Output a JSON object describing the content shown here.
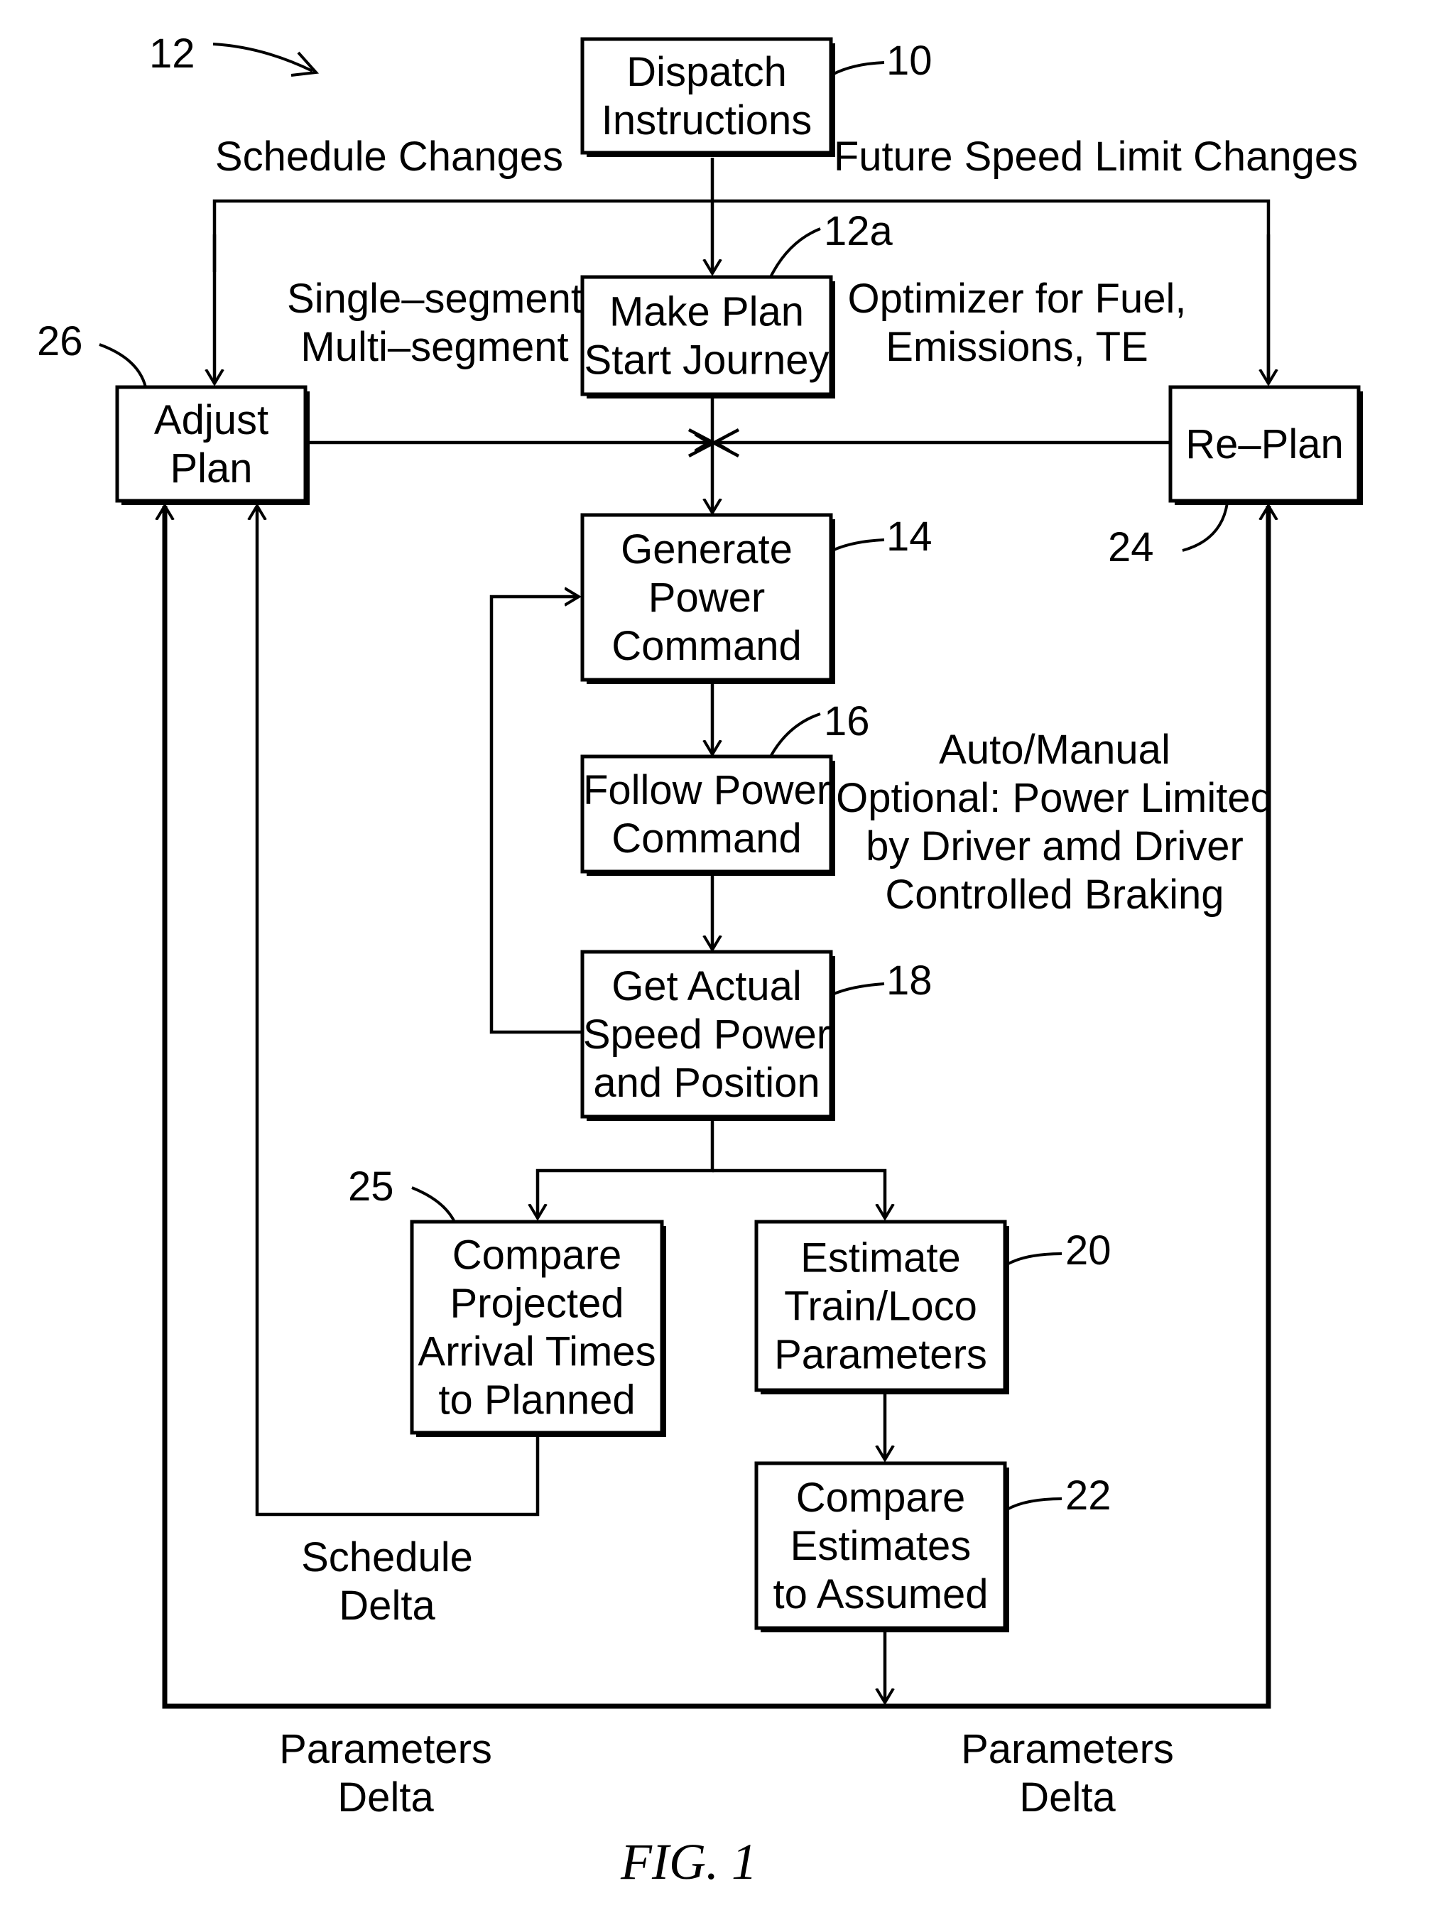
{
  "figure": {
    "title": "FIG. 1",
    "reference_numeral": "12"
  },
  "blocks": [
    {
      "id": "dispatch",
      "ref": "10",
      "lines": [
        "Dispatch",
        "Instructions"
      ]
    },
    {
      "id": "make-plan",
      "ref": "12a",
      "lines": [
        "Make Plan",
        "Start Journey"
      ]
    },
    {
      "id": "adjust-plan",
      "ref": "26",
      "lines": [
        "Adjust",
        "Plan"
      ]
    },
    {
      "id": "re-plan",
      "ref": "24",
      "lines": [
        "Re–Plan"
      ]
    },
    {
      "id": "generate-power",
      "ref": "14",
      "lines": [
        "Generate",
        "Power",
        "Command"
      ]
    },
    {
      "id": "follow-power",
      "ref": "16",
      "lines": [
        "Follow Power",
        "Command"
      ]
    },
    {
      "id": "get-actual",
      "ref": "18",
      "lines": [
        "Get Actual",
        "Speed Power",
        "and Position"
      ]
    },
    {
      "id": "compare-projected",
      "ref": "25",
      "lines": [
        "Compare",
        "Projected",
        "Arrival Times",
        "to Planned"
      ]
    },
    {
      "id": "estimate",
      "ref": "20",
      "lines": [
        "Estimate",
        "Train/Loco",
        "Parameters"
      ]
    },
    {
      "id": "compare-estimates",
      "ref": "22",
      "lines": [
        "Compare",
        "Estimates",
        "to Assumed"
      ]
    }
  ],
  "annotations": {
    "schedule_changes": "Schedule Changes",
    "future_speed_limit_changes": "Future Speed Limit Changes",
    "segment_modes": [
      "Single–segment",
      "Multi–segment"
    ],
    "optimizer": [
      "Optimizer for Fuel,",
      "Emissions, TE"
    ],
    "auto_manual": [
      "Auto/Manual",
      "Optional: Power Limited",
      "by Driver amd Driver",
      "Controlled Braking"
    ],
    "schedule_delta": [
      "Schedule",
      "Delta"
    ],
    "parameters_delta_left": [
      "Parameters",
      "Delta"
    ],
    "parameters_delta_right": [
      "Parameters",
      "Delta"
    ]
  }
}
